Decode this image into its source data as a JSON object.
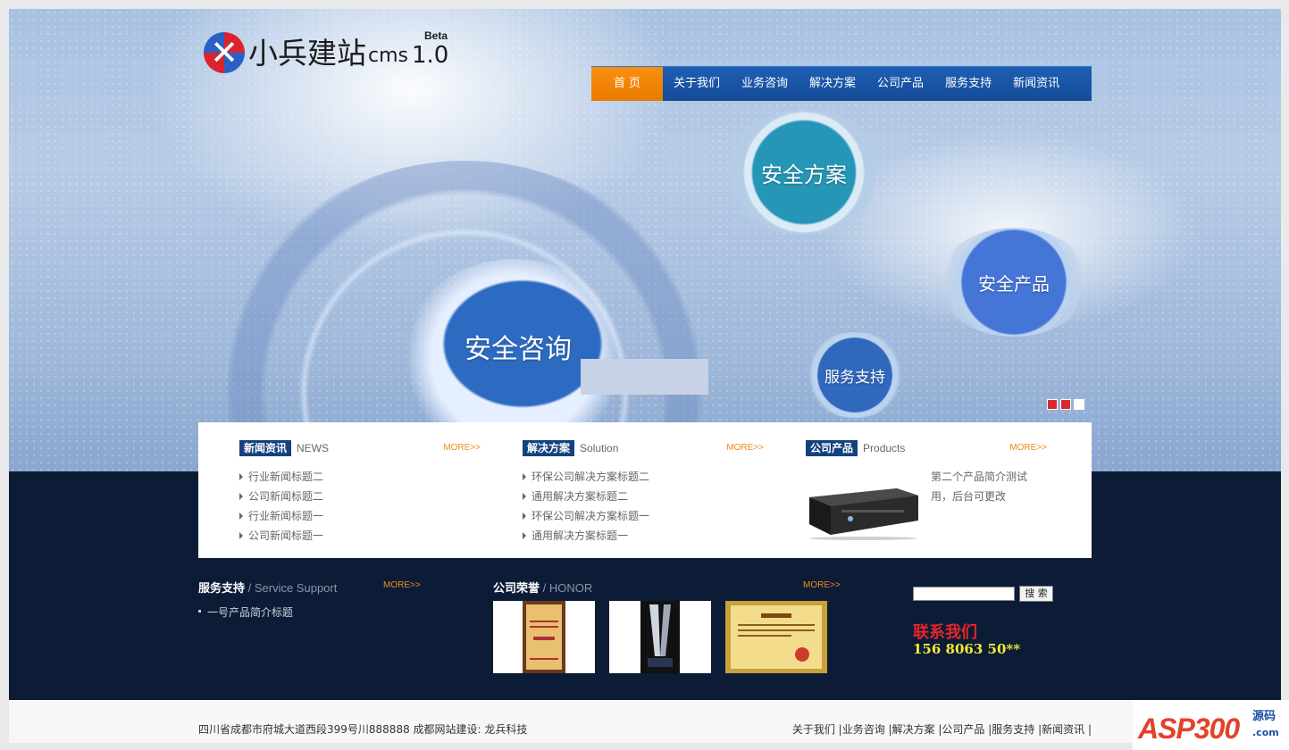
{
  "brand": {
    "name": "小兵建站",
    "cms": "cms",
    "version": "1.0",
    "beta": "Beta"
  },
  "nav": [
    "首 页",
    "关于我们",
    "业务咨询",
    "解决方案",
    "公司产品",
    "服务支持",
    "新闻资讯"
  ],
  "banner": {
    "bubbles": [
      "安全方案",
      "安全产品",
      "安全咨询",
      "服务支持"
    ]
  },
  "news": {
    "tag": "新闻资讯",
    "en": "NEWS",
    "more": "MORE>>",
    "items": [
      "行业新闻标题二",
      "公司新闻标题二",
      "行业新闻标题一",
      "公司新闻标题一"
    ]
  },
  "solution": {
    "tag": "解决方案",
    "en": "Solution",
    "more": "MORE>>",
    "items": [
      "环保公司解决方案标题二",
      "通用解决方案标题二",
      "环保公司解决方案标题一",
      "通用解决方案标题一"
    ]
  },
  "products": {
    "tag": "公司产品",
    "en": "Products",
    "more": "MORE>>",
    "desc": "第二个产品简介测试用，后台可更改"
  },
  "support": {
    "title": "服务支持",
    "en": " / Service Support",
    "more": "MORE>>",
    "item": "一号产品简介标题"
  },
  "honor": {
    "title": "公司荣誉",
    "en": " / HONOR",
    "more": "MORE>>"
  },
  "search": {
    "button": "搜 索",
    "value": ""
  },
  "contact": {
    "title": "联系我们",
    "phone": "156 8063 50**"
  },
  "footer": {
    "left": "四川省成都市府城大道西段399号川888888    成都网站建设: 龙兵科技",
    "right": "关于我们 |业务咨询 |解决方案 |公司产品 |服务支持 |新闻资讯 |"
  },
  "watermark": {
    "main": "ASP300",
    "small": "源码",
    "domain": ".com"
  },
  "colors": {
    "nav": "#1a56a8",
    "nav_active": "#f38a0c",
    "dark": "#0c1c36",
    "tag": "#15427f",
    "more": "#f08a1a",
    "contact": "#e2262a",
    "phone": "#f5e93a"
  }
}
